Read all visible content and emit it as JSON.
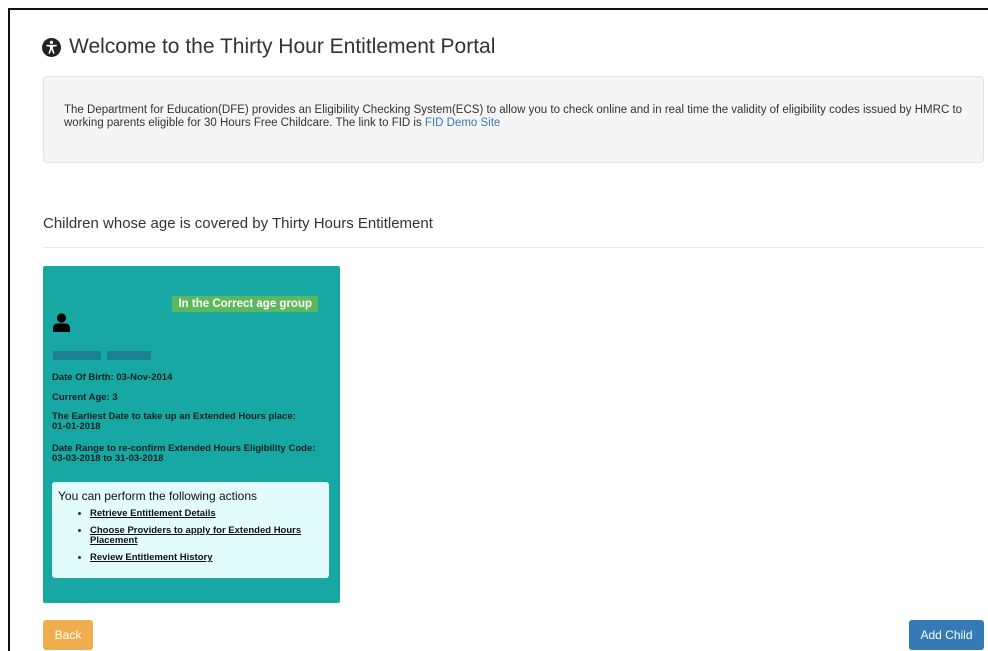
{
  "header": {
    "title": "Welcome to the Thirty Hour Entitlement Portal",
    "icon": "accessibility-icon"
  },
  "intro": {
    "text": "The Department for Education(DFE) provides an Eligibility Checking System(ECS) to allow you to check online and in real time the validity of eligibility codes issued by HMRC to working parents eligible for 30 Hours Free Childcare. The link to FID is ",
    "link_label": "FID Demo Site"
  },
  "section": {
    "title": "Children whose age is covered by Thirty Hours Entitlement"
  },
  "child_card": {
    "badge": "In the Correct age group",
    "icon": "user-icon",
    "date_of_birth": "Date Of Birth: 03-Nov-2014",
    "current_age": "Current Age: 3",
    "earliest_date_label": "The Earliest Date to take up an Extended Hours place:",
    "earliest_date_value": "01-01-2018",
    "range_label": "Date Range to re-confirm Extended Hours Eligibility Code:",
    "range_value": "03-03-2018 to 31-03-2018",
    "actions_heading": "You can perform the following actions",
    "actions": [
      "Retrieve Entitlement Details",
      "Choose Providers to apply for Extended Hours Placement",
      "Review Entitlement History"
    ]
  },
  "buttons": {
    "back": "Back",
    "add_child": "Add Child"
  },
  "colors": {
    "card_bg": "#18a8a4",
    "badge_bg": "#5cb85c",
    "back_button": "#f0ad4e",
    "add_button": "#337ab7",
    "link": "#337ab7"
  }
}
